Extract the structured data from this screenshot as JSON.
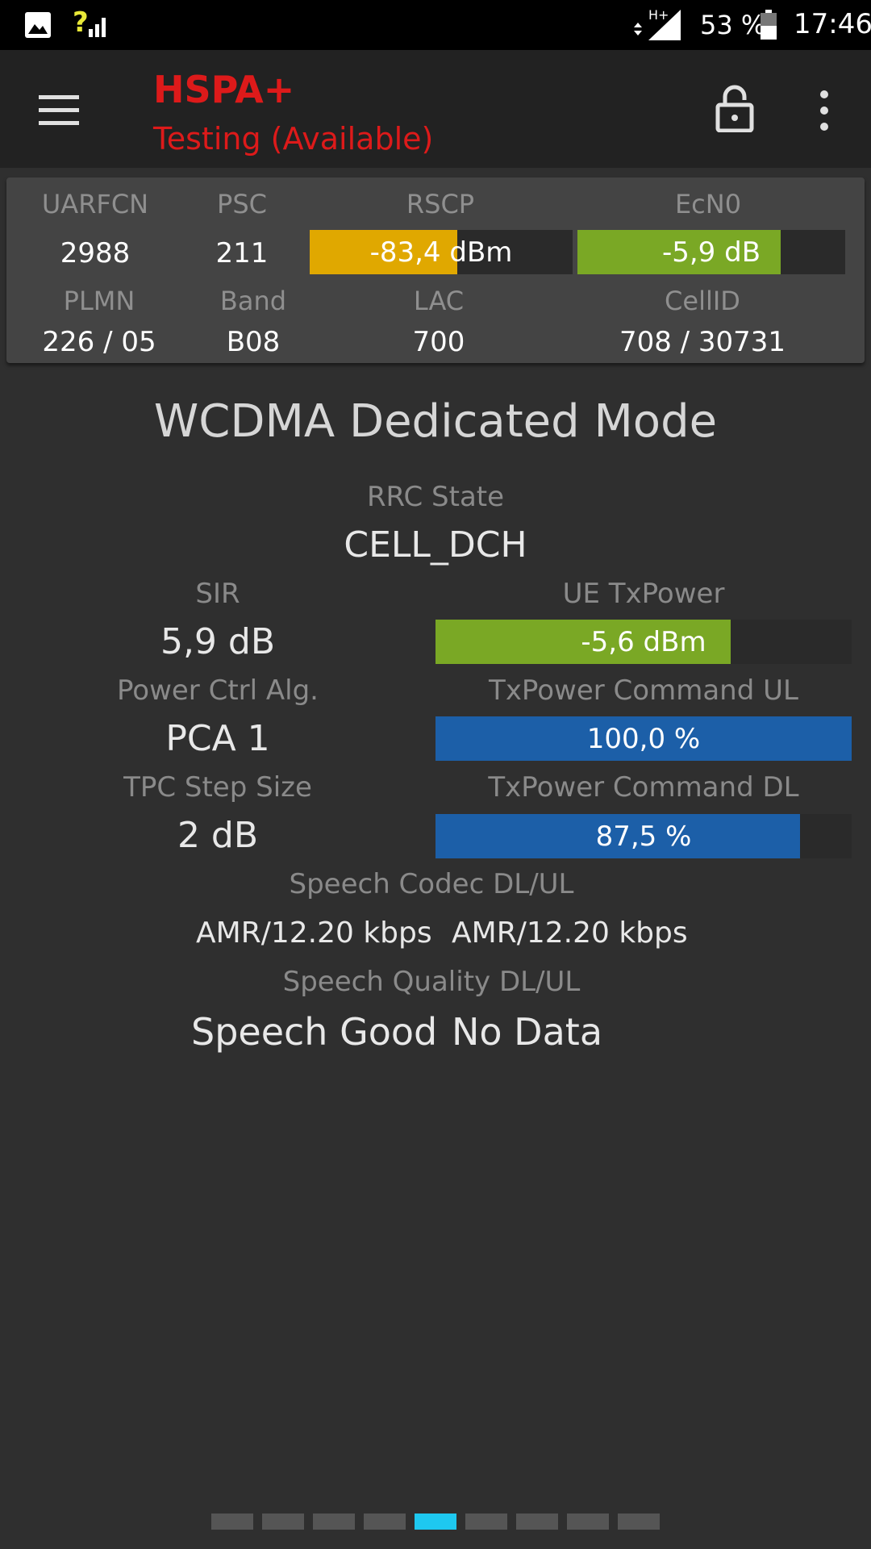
{
  "status_bar": {
    "network_type": "H+",
    "battery_percent": "53 %",
    "time": "17:46"
  },
  "toolbar": {
    "technology": "HSPA+",
    "status": "Testing (Available)"
  },
  "cell_info": {
    "uarfcn_label": "UARFCN",
    "uarfcn": "2988",
    "psc_label": "PSC",
    "psc": "211",
    "rscp_label": "RSCP",
    "rscp": "-83,4 dBm",
    "rscp_fill": 0.56,
    "rscp_color": "#e0a800",
    "ecn0_label": "EcN0",
    "ecn0": "-5,9 dB",
    "ecn0_fill": 0.76,
    "ecn0_color": "#7aa825",
    "plmn_label": "PLMN",
    "plmn": "226 / 05",
    "band_label": "Band",
    "band": "B08",
    "lac_label": "LAC",
    "lac": "700",
    "cellid_label": "CellID",
    "cellid": "708 / 30731"
  },
  "main": {
    "title": "WCDMA Dedicated Mode",
    "rrc_label": "RRC State",
    "rrc": "CELL_DCH",
    "sir_label": "SIR",
    "sir": "5,9 dB",
    "txpower_label": "UE TxPower",
    "txpower": "-5,6 dBm",
    "txpower_fill": 0.71,
    "txpower_color": "#7aa825",
    "pca_label": "Power Ctrl Alg.",
    "pca": "PCA 1",
    "cmd_ul_label": "TxPower Command UL",
    "cmd_ul": "100,0 %",
    "cmd_ul_fill": 1.0,
    "cmd_color": "#1c5fa8",
    "tpc_label": "TPC Step Size",
    "tpc": "2 dB",
    "cmd_dl_label": "TxPower Command DL",
    "cmd_dl": "87,5 %",
    "cmd_dl_fill": 0.875,
    "codec_label": "Speech Codec DL/UL",
    "codec_dl": "AMR/12.20 kbps",
    "codec_ul": "AMR/12.20 kbps",
    "quality_label": "Speech Quality DL/UL",
    "quality_dl": "Speech Good",
    "quality_ul": "No Data"
  },
  "pager": {
    "page_count": 9,
    "active_page": 5
  }
}
